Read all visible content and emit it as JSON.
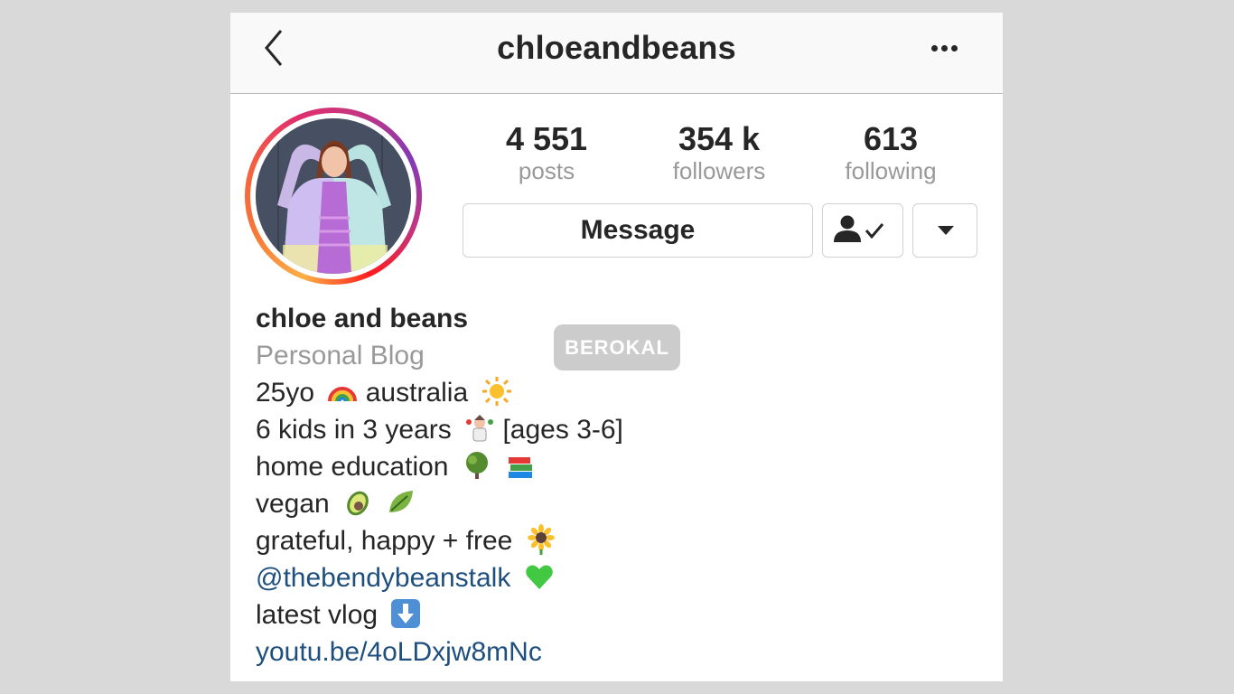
{
  "header": {
    "title": "chloeandbeans",
    "back_icon": "chevron-left-icon",
    "more_icon": "more-horizontal-icon"
  },
  "profile": {
    "avatar_alt": "profile photo"
  },
  "stats": [
    {
      "value": "4 551",
      "label": "posts"
    },
    {
      "value": "354 k",
      "label": "followers"
    },
    {
      "value": "613",
      "label": "following"
    }
  ],
  "actions": {
    "message_label": "Message",
    "following_icon": "user-check-icon",
    "dropdown_icon": "triangle-down-icon"
  },
  "bio": {
    "name": "chloe and beans",
    "category": "Personal Blog",
    "line1": "25yo",
    "line1b": "australia",
    "line2": "6 kids in 3 years",
    "line2b": "[ages 3-6]",
    "line3": "home education",
    "line4": "vegan",
    "line5": "grateful, happy + free",
    "mention": "@thebendybeanstalk",
    "line7": "latest vlog",
    "link": "youtu.be/4oLDxjw8mNc"
  },
  "watermark": "BEROKAL",
  "colors": {
    "link": "#1e4f7e",
    "text": "#262626",
    "secondary": "#999999",
    "ring_start": "#fcaf45",
    "ring_end": "#c13584"
  }
}
